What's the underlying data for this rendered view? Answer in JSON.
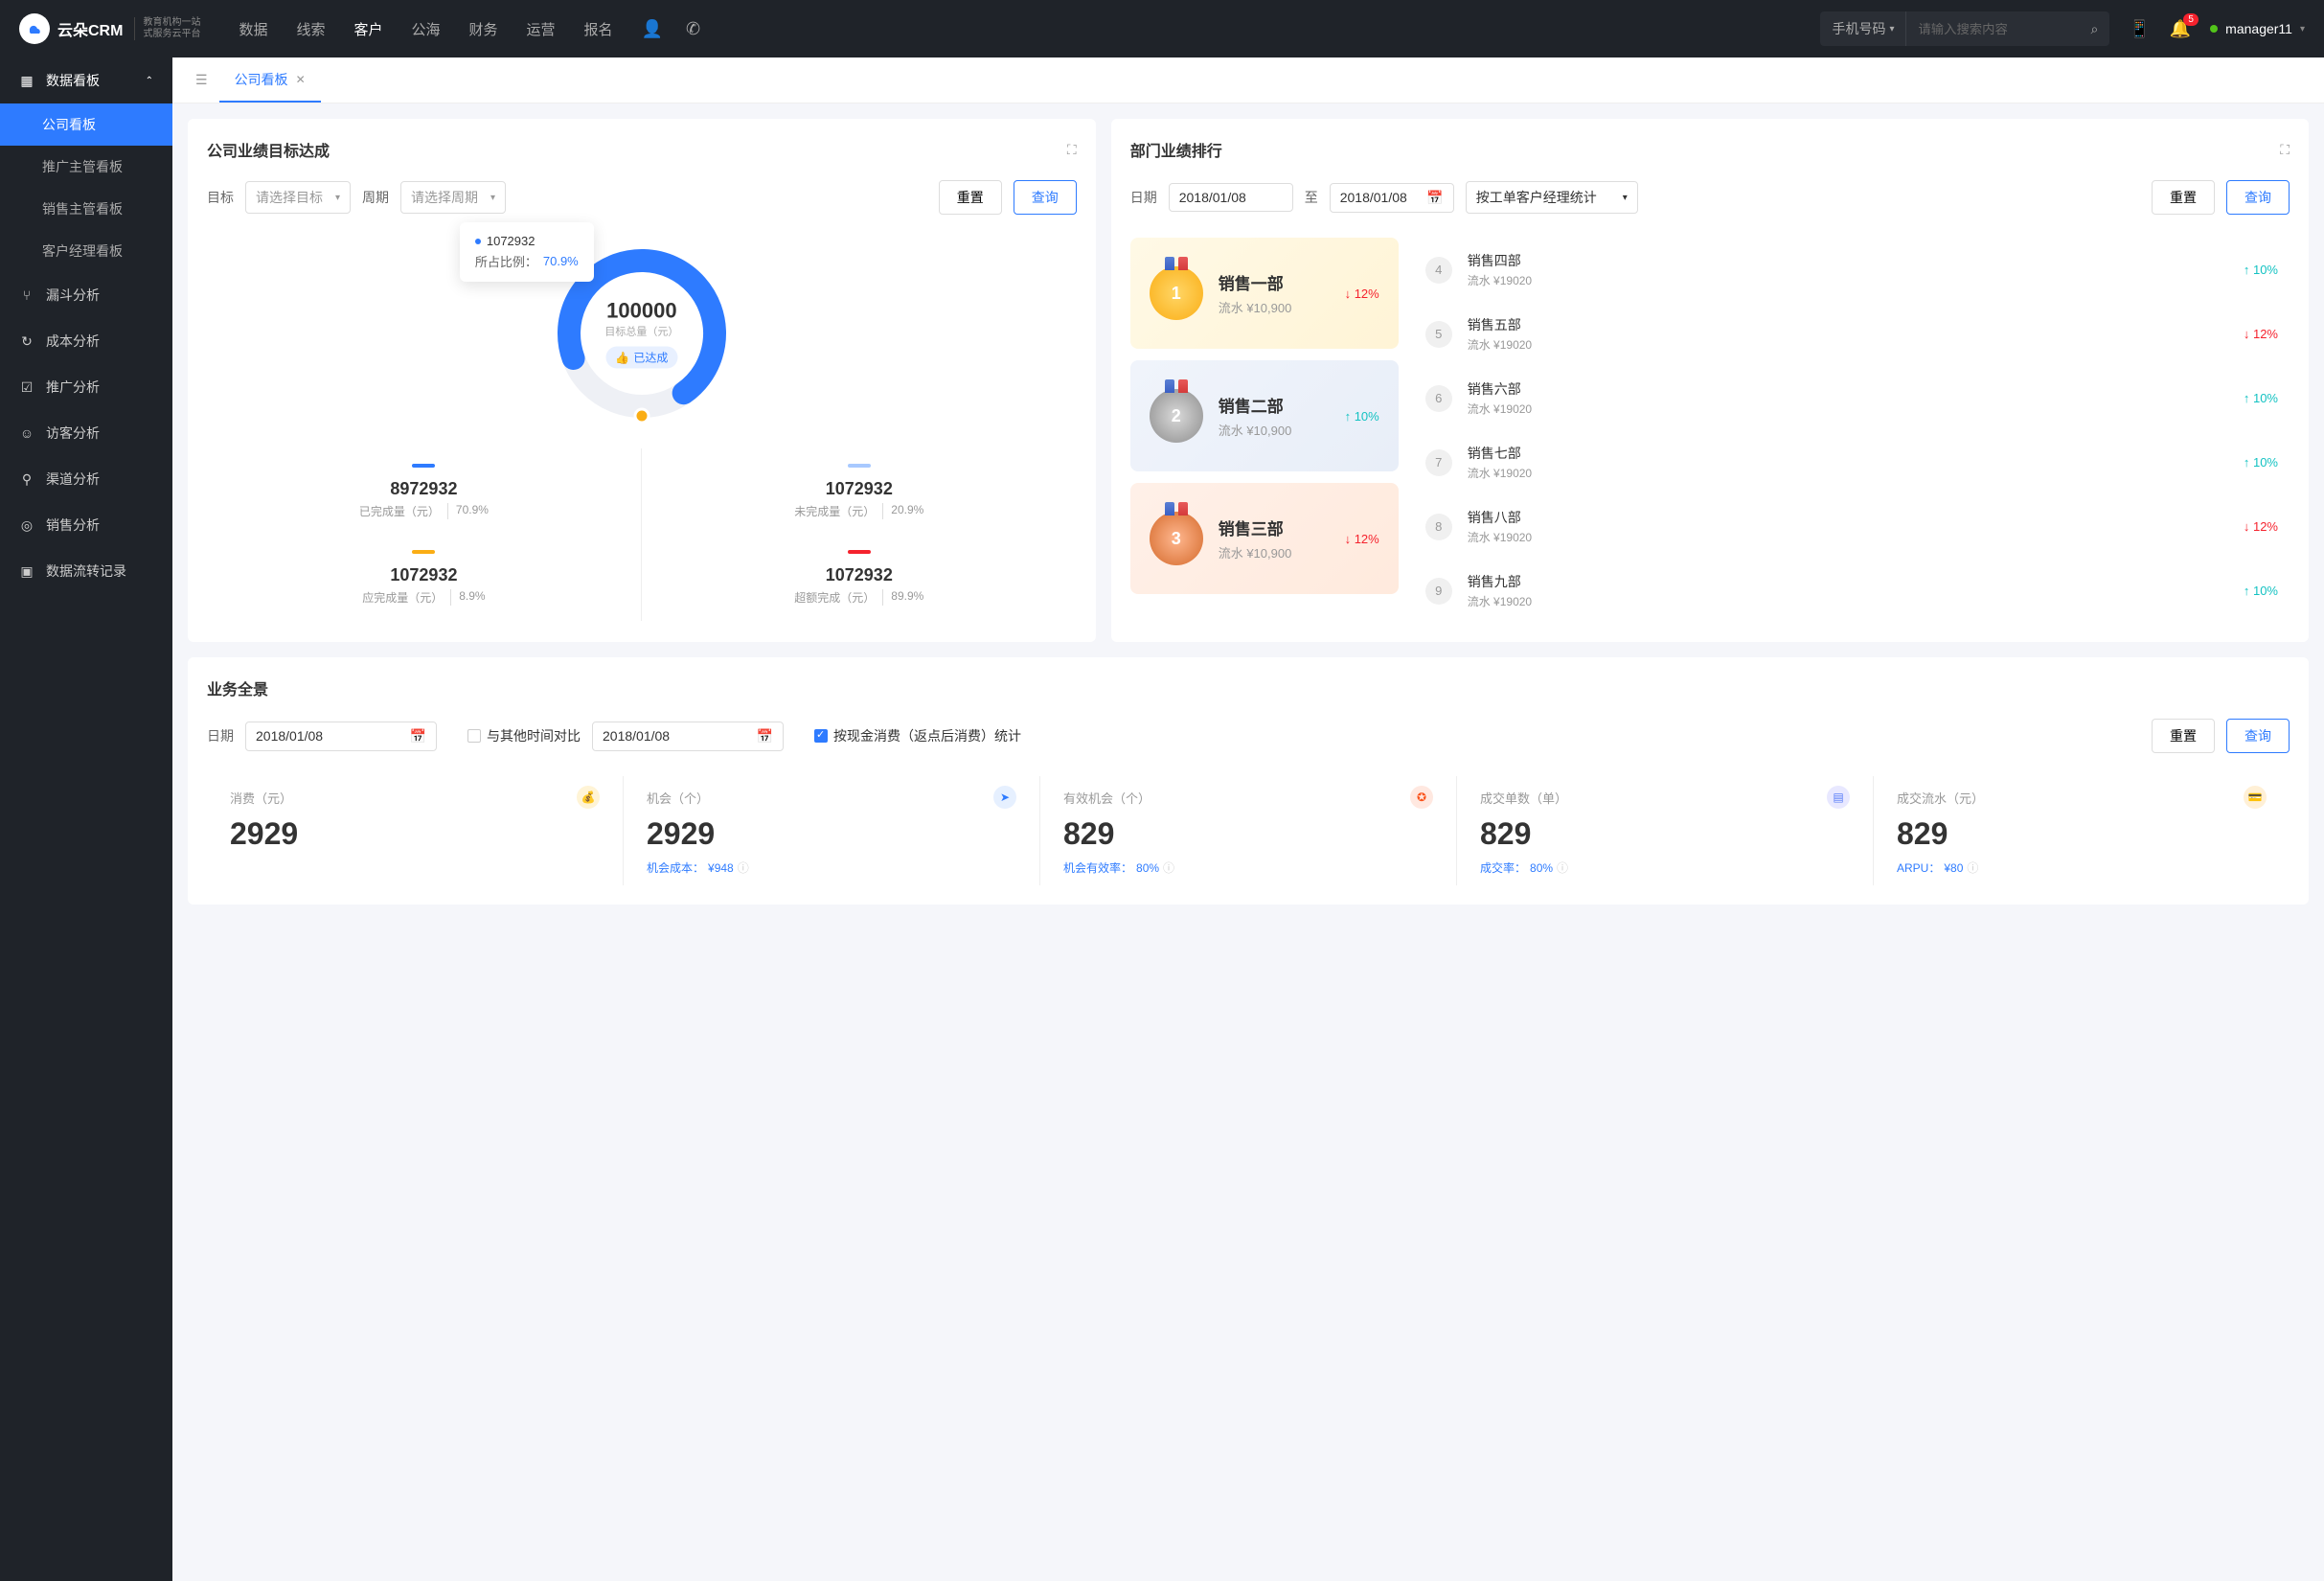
{
  "brand": {
    "name": "云朵CRM",
    "sub1": "教育机构一站",
    "sub2": "式服务云平台"
  },
  "topnav": [
    "数据",
    "线索",
    "客户",
    "公海",
    "财务",
    "运营",
    "报名"
  ],
  "topnav_active": 2,
  "search": {
    "type": "手机号码",
    "placeholder": "请输入搜索内容"
  },
  "notification_count": "5",
  "user": "manager11",
  "sidebar": {
    "group": "数据看板",
    "items": [
      "公司看板",
      "推广主管看板",
      "销售主管看板",
      "客户经理看板"
    ],
    "active": 0,
    "others": [
      "漏斗分析",
      "成本分析",
      "推广分析",
      "访客分析",
      "渠道分析",
      "销售分析",
      "数据流转记录"
    ],
    "other_icons": [
      "⑂",
      "↻",
      "☑",
      "☺",
      "⚲",
      "◎",
      "▣"
    ]
  },
  "tab": {
    "label": "公司看板"
  },
  "goal": {
    "title": "公司业绩目标达成",
    "target_label": "目标",
    "target_placeholder": "请选择目标",
    "period_label": "周期",
    "period_placeholder": "请选择周期",
    "reset": "重置",
    "query": "查询",
    "total": "100000",
    "total_label": "目标总量（元）",
    "badge": "已达成",
    "tooltip_val": "1072932",
    "tooltip_label": "所占比例：",
    "tooltip_pct": "70.9%",
    "stats": [
      {
        "color": "#2e7bff",
        "num": "8972932",
        "label": "已完成量（元）",
        "pct": "70.9%"
      },
      {
        "color": "#a8c9ff",
        "num": "1072932",
        "label": "未完成量（元）",
        "pct": "20.9%"
      },
      {
        "color": "#faad14",
        "num": "1072932",
        "label": "应完成量（元）",
        "pct": "8.9%"
      },
      {
        "color": "#f5222d",
        "num": "1072932",
        "label": "超额完成（元）",
        "pct": "89.9%"
      }
    ]
  },
  "rank": {
    "title": "部门业绩排行",
    "date_label": "日期",
    "date_from": "2018/01/08",
    "date_sep": "至",
    "date_to": "2018/01/08",
    "filter": "按工单客户经理统计",
    "reset": "重置",
    "query": "查询",
    "top": [
      {
        "n": "1",
        "name": "销售一部",
        "rev": "流水 ¥10,900",
        "pct": "12%",
        "dir": "down"
      },
      {
        "n": "2",
        "name": "销售二部",
        "rev": "流水 ¥10,900",
        "pct": "10%",
        "dir": "up"
      },
      {
        "n": "3",
        "name": "销售三部",
        "rev": "流水 ¥10,900",
        "pct": "12%",
        "dir": "down"
      }
    ],
    "rest": [
      {
        "n": "4",
        "name": "销售四部",
        "rev": "流水 ¥19020",
        "pct": "10%",
        "dir": "up"
      },
      {
        "n": "5",
        "name": "销售五部",
        "rev": "流水 ¥19020",
        "pct": "12%",
        "dir": "down"
      },
      {
        "n": "6",
        "name": "销售六部",
        "rev": "流水 ¥19020",
        "pct": "10%",
        "dir": "up"
      },
      {
        "n": "7",
        "name": "销售七部",
        "rev": "流水 ¥19020",
        "pct": "10%",
        "dir": "up"
      },
      {
        "n": "8",
        "name": "销售八部",
        "rev": "流水 ¥19020",
        "pct": "12%",
        "dir": "down"
      },
      {
        "n": "9",
        "name": "销售九部",
        "rev": "流水 ¥19020",
        "pct": "10%",
        "dir": "up"
      }
    ]
  },
  "overview": {
    "title": "业务全景",
    "date_label": "日期",
    "date1": "2018/01/08",
    "compare_label": "与其他时间对比",
    "date2": "2018/01/08",
    "check_label": "按现金消费（返点后消费）统计",
    "reset": "重置",
    "query": "查询",
    "kpis": [
      {
        "label": "消费（元）",
        "val": "2929",
        "sub": "",
        "sub_val": "",
        "icon_bg": "#fff4d6",
        "icon_fg": "#faad14",
        "icon": "💰"
      },
      {
        "label": "机会（个）",
        "val": "2929",
        "sub": "机会成本：",
        "sub_val": "¥948",
        "icon_bg": "#e6f0ff",
        "icon_fg": "#2e7bff",
        "icon": "➤"
      },
      {
        "label": "有效机会（个）",
        "val": "829",
        "sub": "机会有效率：",
        "sub_val": "80%",
        "icon_bg": "#ffe8e0",
        "icon_fg": "#fa541c",
        "icon": "✪"
      },
      {
        "label": "成交单数（单）",
        "val": "829",
        "sub": "成交率：",
        "sub_val": "80%",
        "icon_bg": "#e8e8ff",
        "icon_fg": "#597ef7",
        "icon": "▤"
      },
      {
        "label": "成交流水（元）",
        "val": "829",
        "sub": "ARPU：",
        "sub_val": "¥80",
        "icon_bg": "#fff0d6",
        "icon_fg": "#fa8c16",
        "icon": "💳"
      }
    ]
  },
  "chart_data": {
    "type": "pie",
    "title": "目标总量（元）",
    "total": 100000,
    "series": [
      {
        "name": "已完成",
        "value": 70.9,
        "color": "#2e7bff"
      },
      {
        "name": "未完成",
        "value": 29.1,
        "color": "#e8e8e8"
      }
    ]
  }
}
